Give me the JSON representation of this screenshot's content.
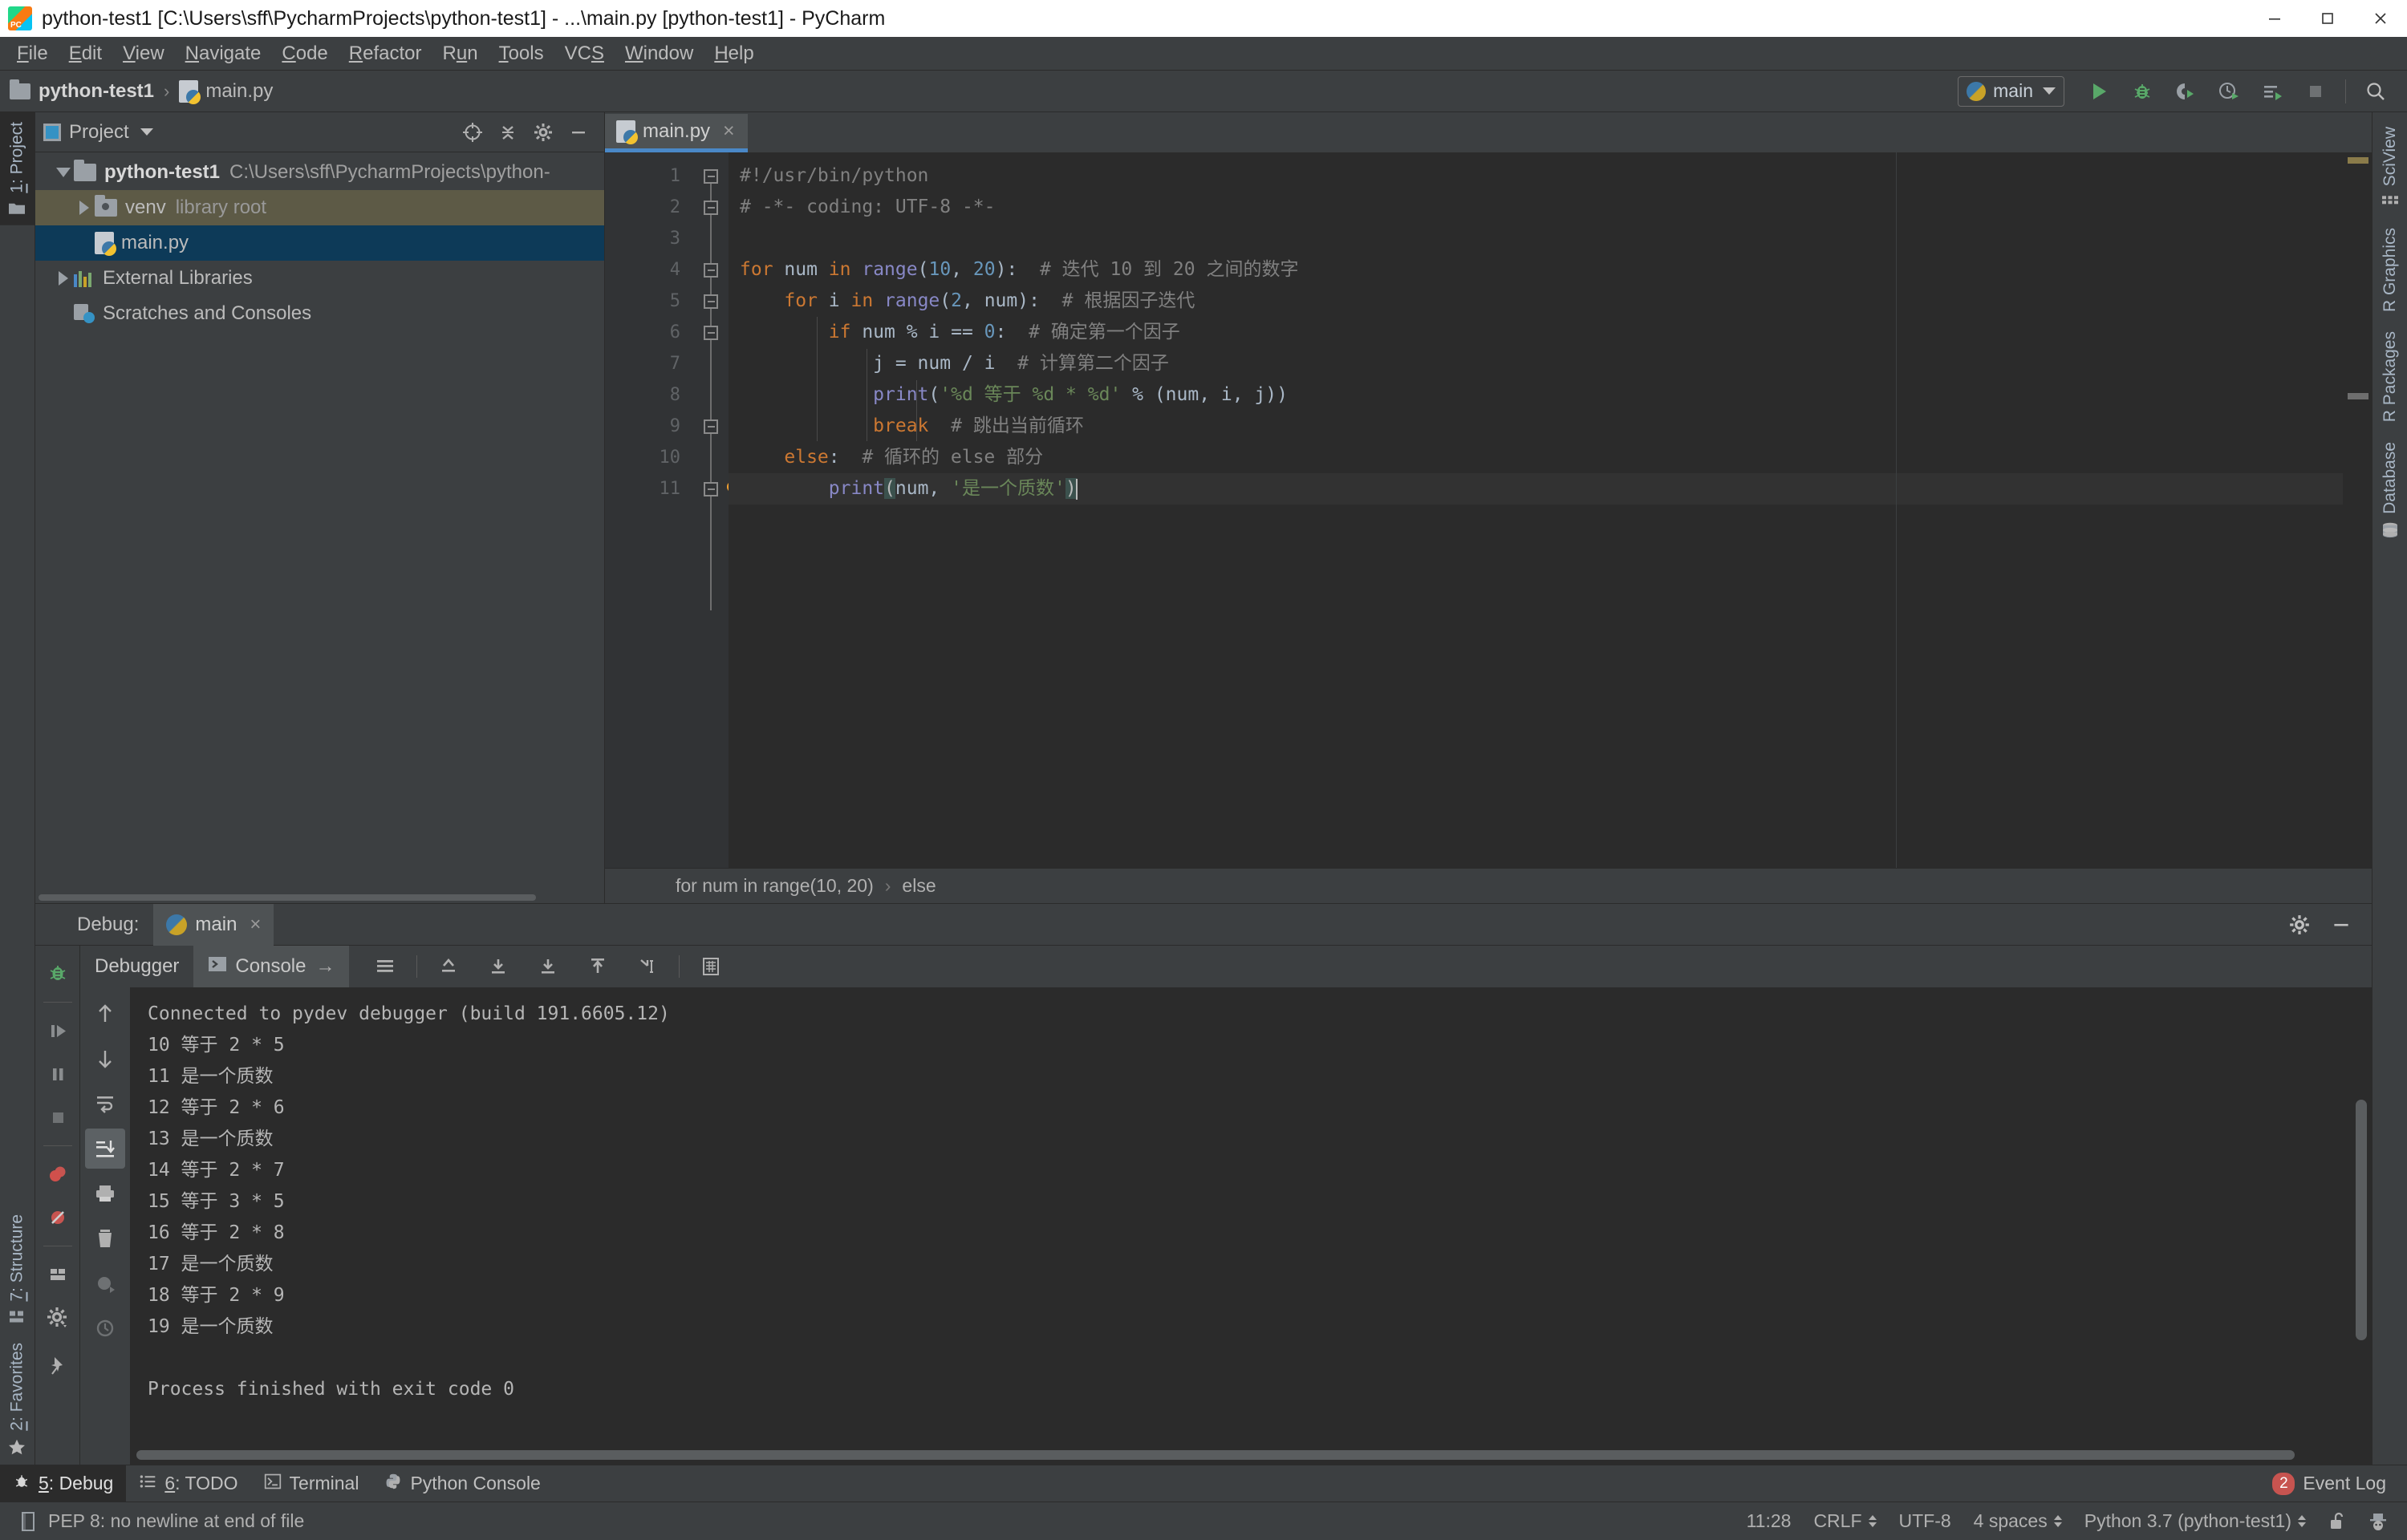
{
  "window": {
    "title": "python-test1 [C:\\Users\\sff\\PycharmProjects\\python-test1] - ...\\main.py [python-test1] - PyCharm",
    "app_icon": "pycharm-icon",
    "minimize_label": "Minimize",
    "maximize_label": "Maximize",
    "close_label": "Close"
  },
  "menubar": {
    "items": [
      {
        "label": "File",
        "mnemonic": "F"
      },
      {
        "label": "Edit",
        "mnemonic": "E"
      },
      {
        "label": "View",
        "mnemonic": "V"
      },
      {
        "label": "Navigate",
        "mnemonic": "N"
      },
      {
        "label": "Code",
        "mnemonic": "C"
      },
      {
        "label": "Refactor",
        "mnemonic": "R"
      },
      {
        "label": "Run",
        "mnemonic": "u"
      },
      {
        "label": "Tools",
        "mnemonic": "T"
      },
      {
        "label": "VCS",
        "mnemonic": "S"
      },
      {
        "label": "Window",
        "mnemonic": "W"
      },
      {
        "label": "Help",
        "mnemonic": "H"
      }
    ]
  },
  "navbar": {
    "breadcrumb": [
      {
        "label": "python-test1",
        "icon": "folder-icon"
      },
      {
        "label": "main.py",
        "icon": "python-file-icon"
      }
    ],
    "separator": "›",
    "run_config": "main",
    "buttons": [
      {
        "name": "run-button",
        "title": "Run"
      },
      {
        "name": "debug-button",
        "title": "Debug"
      },
      {
        "name": "run-coverage-button",
        "title": "Run with Coverage"
      },
      {
        "name": "profile-button",
        "title": "Profile"
      },
      {
        "name": "run-tests-button",
        "title": "Run Tests"
      },
      {
        "name": "stop-button",
        "title": "Stop"
      },
      {
        "name": "search-everywhere-button",
        "title": "Search Everywhere"
      }
    ]
  },
  "left_strip": {
    "top_tab": {
      "label": "1: Project",
      "number": "1",
      "text": ": Project"
    },
    "bottom_tabs": [
      {
        "label": "7: Structure",
        "icon": "structure-icon"
      },
      {
        "label": "2: Favorites",
        "icon": "star-icon"
      }
    ]
  },
  "right_strip": {
    "tabs": [
      {
        "label": "SciView",
        "icon": "sciview-icon"
      },
      {
        "label": "R Graphics",
        "icon": "none"
      },
      {
        "label": "R Packages",
        "icon": "none"
      },
      {
        "label": "Database",
        "icon": "database-icon"
      }
    ]
  },
  "project_panel": {
    "title": "Project",
    "header_buttons": [
      {
        "name": "select-opened-file-button"
      },
      {
        "name": "collapse-all-button"
      },
      {
        "name": "settings-gear-button"
      },
      {
        "name": "hide-panel-button"
      }
    ],
    "tree": [
      {
        "label": "python-test1",
        "detail": "C:\\Users\\sff\\PycharmProjects\\python-",
        "icon": "folder-icon",
        "state": "expanded",
        "depth": 0,
        "selected": false
      },
      {
        "label": "venv",
        "detail": "library root",
        "icon": "venv-folder-icon",
        "state": "collapsed",
        "depth": 1,
        "selected": "venv"
      },
      {
        "label": "main.py",
        "detail": "",
        "icon": "python-file-icon",
        "state": "leaf",
        "depth": 2,
        "selected": "main"
      },
      {
        "label": "External Libraries",
        "detail": "",
        "icon": "library-icon",
        "state": "collapsed",
        "depth": 0,
        "selected": false
      },
      {
        "label": "Scratches and Consoles",
        "detail": "",
        "icon": "scratches-icon",
        "state": "leaf",
        "depth": 1,
        "selected": false
      }
    ]
  },
  "editor": {
    "tabs": [
      {
        "label": "main.py",
        "icon": "python-file-icon",
        "active": true,
        "close": "×"
      }
    ],
    "line_numbers": [
      "1",
      "2",
      "3",
      "4",
      "5",
      "6",
      "7",
      "8",
      "9",
      "10",
      "11"
    ],
    "code_lines": [
      {
        "n": 1,
        "tokens": [
          {
            "t": "#!/usr/bin/python",
            "c": "cmt"
          }
        ],
        "fold": "start"
      },
      {
        "n": 2,
        "tokens": [
          {
            "t": "# -*- coding: UTF-8 -*-",
            "c": "cmt"
          }
        ],
        "fold": "end"
      },
      {
        "n": 3,
        "tokens": [],
        "fold": "none"
      },
      {
        "n": 4,
        "tokens": [
          {
            "t": "for",
            "c": "kw"
          },
          {
            "t": " num ",
            "c": "pln"
          },
          {
            "t": "in",
            "c": "kw"
          },
          {
            "t": " ",
            "c": "pln"
          },
          {
            "t": "range",
            "c": "fn"
          },
          {
            "t": "(",
            "c": "pln"
          },
          {
            "t": "10",
            "c": "num"
          },
          {
            "t": ", ",
            "c": "pln"
          },
          {
            "t": "20",
            "c": "num"
          },
          {
            "t": "):  ",
            "c": "pln"
          },
          {
            "t": "# 迭代 10 到 20 之间的数字",
            "c": "cmt"
          }
        ],
        "fold": "start"
      },
      {
        "n": 5,
        "tokens": [
          {
            "t": "    ",
            "c": "pln"
          },
          {
            "t": "for",
            "c": "kw"
          },
          {
            "t": " i ",
            "c": "pln"
          },
          {
            "t": "in",
            "c": "kw"
          },
          {
            "t": " ",
            "c": "pln"
          },
          {
            "t": "range",
            "c": "fn"
          },
          {
            "t": "(",
            "c": "pln"
          },
          {
            "t": "2",
            "c": "num"
          },
          {
            "t": ", num):  ",
            "c": "pln"
          },
          {
            "t": "# 根据因子迭代",
            "c": "cmt"
          }
        ],
        "fold": "start"
      },
      {
        "n": 6,
        "tokens": [
          {
            "t": "        ",
            "c": "pln"
          },
          {
            "t": "if",
            "c": "kw"
          },
          {
            "t": " num % i == ",
            "c": "pln"
          },
          {
            "t": "0",
            "c": "num"
          },
          {
            "t": ":  ",
            "c": "pln"
          },
          {
            "t": "# 确定第一个因子",
            "c": "cmt"
          }
        ],
        "fold": "start"
      },
      {
        "n": 7,
        "tokens": [
          {
            "t": "            j = num / i  ",
            "c": "pln"
          },
          {
            "t": "# 计算第二个因子",
            "c": "cmt"
          }
        ],
        "fold": "none"
      },
      {
        "n": 8,
        "tokens": [
          {
            "t": "            ",
            "c": "pln"
          },
          {
            "t": "print",
            "c": "fn"
          },
          {
            "t": "(",
            "c": "pln"
          },
          {
            "t": "'%d 等于 %d * %d'",
            "c": "str"
          },
          {
            "t": " % (num, i, j))",
            "c": "pln"
          }
        ],
        "fold": "none"
      },
      {
        "n": 9,
        "tokens": [
          {
            "t": "            ",
            "c": "pln"
          },
          {
            "t": "break",
            "c": "kw"
          },
          {
            "t": "  ",
            "c": "pln"
          },
          {
            "t": "# 跳出当前循环",
            "c": "cmt"
          }
        ],
        "fold": "end"
      },
      {
        "n": 10,
        "tokens": [
          {
            "t": "    ",
            "c": "pln"
          },
          {
            "t": "else",
            "c": "kw"
          },
          {
            "t": ":  ",
            "c": "pln"
          },
          {
            "t": "# 循环的 else 部分",
            "c": "cmt"
          }
        ],
        "fold": "none"
      },
      {
        "n": 11,
        "tokens": [
          {
            "t": "        ",
            "c": "pln"
          },
          {
            "t": "print",
            "c": "fn"
          },
          {
            "t": "(",
            "c": "hl"
          },
          {
            "t": "num, ",
            "c": "pln"
          },
          {
            "t": "'是一个质数'",
            "c": "str"
          },
          {
            "t": ")",
            "c": "hl"
          }
        ],
        "fold": "end",
        "current": true,
        "bulb": true
      }
    ],
    "breadcrumb": [
      "for num in range(10, 20)",
      "else"
    ],
    "breadcrumb_sep": "›"
  },
  "debug_panel": {
    "header_label": "Debug:",
    "run_tab": "main",
    "run_tab_close": "×",
    "settings_button": "gear-icon",
    "hide_button": "hide-icon",
    "tabs": [
      {
        "label": "Debugger",
        "active": false,
        "icon": "none"
      },
      {
        "label": "Console",
        "active": true,
        "icon": "console-icon",
        "suffix": "→"
      }
    ],
    "left_buttons": [
      {
        "name": "debug-bug-icon"
      },
      {
        "name": "resume-program-button"
      },
      {
        "name": "pause-program-button"
      },
      {
        "name": "stop-button"
      },
      {
        "name": "view-breakpoints-button"
      },
      {
        "name": "mute-breakpoints-button"
      },
      {
        "name": "layout-settings-button"
      },
      {
        "name": "settings-gear-button"
      },
      {
        "name": "pin-tab-button"
      }
    ],
    "tool_buttons": [
      {
        "name": "scroll-up-button"
      },
      {
        "name": "scroll-down-button"
      },
      {
        "name": "soft-wrap-button"
      },
      {
        "name": "scroll-to-end-button",
        "active": true
      },
      {
        "name": "print-button"
      },
      {
        "name": "clear-all-button"
      },
      {
        "name": "python-console-button"
      },
      {
        "name": "history-button"
      }
    ],
    "console_lines": [
      "Connected to pydev debugger (build 191.6605.12)",
      "10 等于 2 * 5",
      "11 是一个质数",
      "12 等于 2 * 6",
      "13 是一个质数",
      "14 等于 2 * 7",
      "15 等于 3 * 5",
      "16 等于 2 * 8",
      "17 是一个质数",
      "18 等于 2 * 9",
      "19 是一个质数",
      "",
      "Process finished with exit code 0"
    ]
  },
  "bottom_bar": {
    "tabs": [
      {
        "label": "5: Debug",
        "mnemonic": "5",
        "rest": ": Debug",
        "icon": "bug-icon",
        "active": true
      },
      {
        "label": "6: TODO",
        "mnemonic": "6",
        "rest": ": TODO",
        "icon": "todo-icon",
        "active": false
      },
      {
        "label": "Terminal",
        "mnemonic": "",
        "rest": "Terminal",
        "icon": "terminal-icon",
        "active": false
      },
      {
        "label": "Python Console",
        "mnemonic": "",
        "rest": "Python Console",
        "icon": "python-icon",
        "active": false
      }
    ],
    "event_log": {
      "label": "Event Log",
      "count": "2"
    }
  },
  "status_bar": {
    "message": "PEP 8: no newline at end of file",
    "message_icon": "inspection-icon",
    "caret_position": "11:28",
    "line_separator": "CRLF",
    "encoding": "UTF-8",
    "indent": "4 spaces",
    "interpreter": "Python 3.7 (python-test1)",
    "lock_icon": "unlocked-icon",
    "hector_icon": "hector-icon"
  },
  "colors": {
    "chrome": "#3c3f41",
    "editor_bg": "#2b2b2b",
    "tab_accent": "#4a88c7",
    "selection": "#0d3a58",
    "venv_highlight": "#5d5a46",
    "keyword": "#cc7832",
    "string": "#6a8759",
    "number": "#6897bb",
    "comment": "#808080",
    "function": "#8888c6",
    "plain": "#a9b7c6",
    "badge_red": "#c75450",
    "green_run": "#59a869"
  }
}
